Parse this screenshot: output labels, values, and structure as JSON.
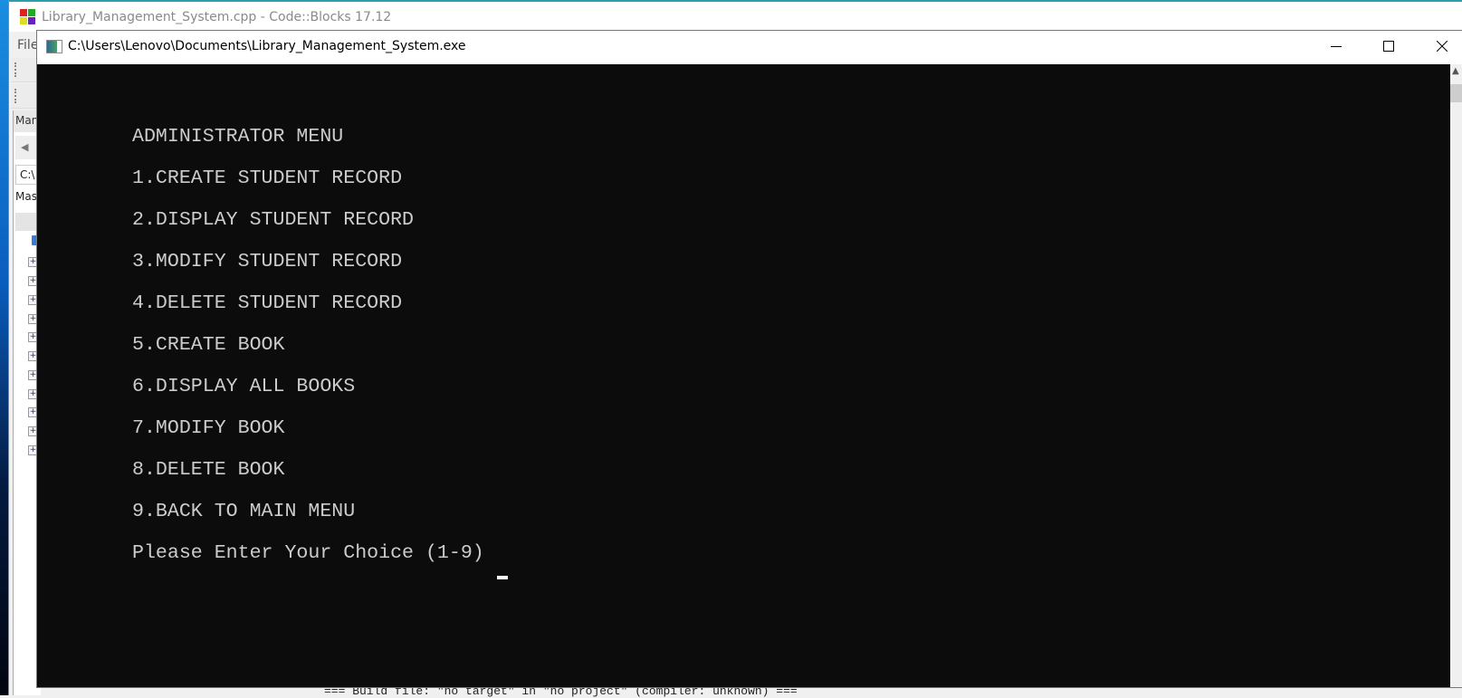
{
  "codeblocks": {
    "title": "Library_Management_System.cpp - Code::Blocks 17.12",
    "menu_file": "File",
    "panel_tab": "Mana",
    "path_box": "C:\\",
    "mask_label": "Mask",
    "build_log": "=== Build file: \"no target\" in \"no project\" (compiler: unknown) ==="
  },
  "console": {
    "title": "C:\\Users\\Lenovo\\Documents\\Library_Management_System.exe",
    "lines": [
      "ADMINISTRATOR MENU",
      "1.CREATE STUDENT RECORD",
      "2.DISPLAY STUDENT RECORD",
      "3.MODIFY STUDENT RECORD",
      "4.DELETE STUDENT RECORD",
      "5.CREATE BOOK",
      "6.DISPLAY ALL BOOKS",
      "7.MODIFY BOOK",
      "8.DELETE BOOK",
      "9.BACK TO MAIN MENU",
      "Please Enter Your Choice (1-9) "
    ]
  }
}
